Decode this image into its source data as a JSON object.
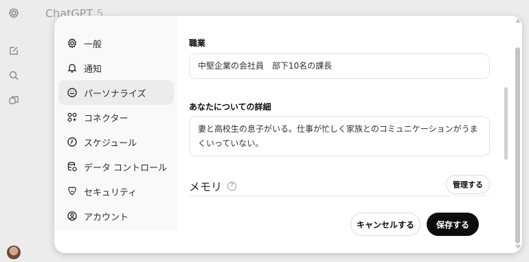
{
  "app": {
    "title": "ChatGPT",
    "version": "5",
    "chevron": "⌄"
  },
  "rail": {
    "icons": [
      "openai-logo-icon",
      "new-chat-icon",
      "search-icon",
      "library-icon"
    ]
  },
  "nav": {
    "items": [
      {
        "label": "一般",
        "icon": "gear-icon"
      },
      {
        "label": "通知",
        "icon": "bell-icon"
      },
      {
        "label": "パーソナライズ",
        "icon": "personalize-icon",
        "active": true
      },
      {
        "label": "コネクター",
        "icon": "connectors-icon"
      },
      {
        "label": "スケジュール",
        "icon": "clock-icon"
      },
      {
        "label": "データ コントロール",
        "icon": "database-icon"
      },
      {
        "label": "セキュリティ",
        "icon": "security-icon"
      },
      {
        "label": "アカウント",
        "icon": "account-icon"
      }
    ]
  },
  "form": {
    "occupation_label": "職業",
    "occupation_value": "中堅企業の会社員　部下10名の課長",
    "about_label": "あなたについての詳細",
    "about_value": "妻と高校生の息子がいる。仕事が忙しく家族とのコミュニケーションがうまくいっていない。",
    "memory_label": "メモリ",
    "help_symbol": "?",
    "manage_label": "管理する"
  },
  "footer": {
    "cancel_label": "キャンセルする",
    "save_label": "保存する"
  },
  "colors": {
    "primary_button": "#0d0d0d",
    "nav_active": "#ececec",
    "nav_bg": "#f9f9f9"
  }
}
